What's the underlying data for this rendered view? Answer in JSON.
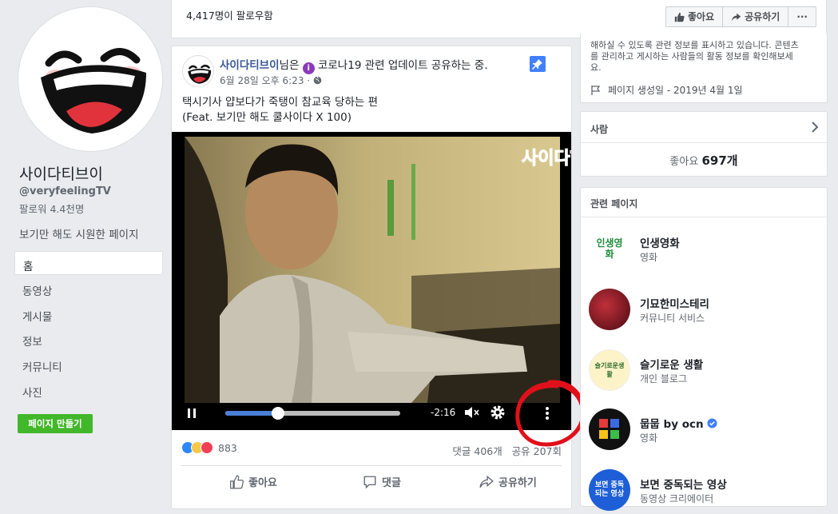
{
  "page": {
    "name": "사이다티브이",
    "handle": "@veryfeelingTV",
    "followers": "팔로워 4.4천명",
    "tagline": "보기만 해도 시원한 페이지",
    "create_page_button": "페이지 만들기"
  },
  "nav": [
    "홈",
    "동영상",
    "게시물",
    "정보",
    "커뮤니티",
    "사진"
  ],
  "topbar": {
    "followers_text": "4,417명이 팔로우함",
    "like_label": "좋아요",
    "share_label": "공유하기",
    "more_label": "···"
  },
  "post": {
    "author": "사이다티브이",
    "author_suffix": "님은",
    "activity": "코로나19 관련 업데이트 공유하는 중.",
    "time": "6월 28일 오후 6:23 · ",
    "text_line1": "택시기사 얍보다가 죽탱이 참교육 당하는 편",
    "text_line2": "(Feat. 보기만 해도 쿨사이다 X 100)",
    "video": {
      "watermark": "사이다TV",
      "time_remaining": "-2:16",
      "progress": 0.3
    },
    "reaction_count": "883",
    "comment_count": "댓글 406개",
    "share_count": "공유 207회",
    "actions": {
      "like": "좋아요",
      "comment": "댓글",
      "share": "공유하기"
    }
  },
  "right": {
    "about_text_line1": "해하실 수 있도록 관련 정보를 표시하고 있습니다. 콘텐츠",
    "about_text_line2": "를 관리하고 게시하는 사람들의 활동 정보를 확인해보세",
    "about_text_line3": "요.",
    "created_date": "페이지 생성일 - 2019년 4월 1일",
    "people_title": "사람",
    "likes_label": "좋아요",
    "likes_count": "697개",
    "related_title": "관련 페이지",
    "related": [
      {
        "name": "인생영화",
        "category": "영화",
        "thumb_text": "인생영화"
      },
      {
        "name": "기묘한미스테리",
        "category": "커뮤니티 서비스",
        "thumb_text": ""
      },
      {
        "name": "슬기로운 생활",
        "category": "개인 블로그",
        "thumb_text": "슬기로운생활"
      },
      {
        "name": "뭅뭅 by ocn",
        "category": "영화",
        "thumb_text": ""
      },
      {
        "name": "보면 중독되는 영상",
        "category": "동영상 크리에이터",
        "thumb_text": "보면 중독되는 영상"
      }
    ]
  },
  "colors": {
    "brand_blue": "#385898",
    "create_green": "#42b72a",
    "annotation_red": "#e0101a"
  }
}
